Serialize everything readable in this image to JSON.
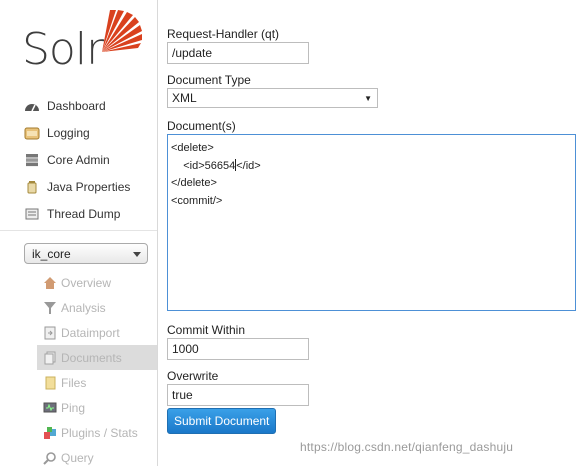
{
  "brand": {
    "logo_text": "Solr",
    "accent": "#d9411e"
  },
  "nav": {
    "items": [
      {
        "label": "Dashboard",
        "icon": "dashboard-icon"
      },
      {
        "label": "Logging",
        "icon": "logging-icon"
      },
      {
        "label": "Core Admin",
        "icon": "core-admin-icon"
      },
      {
        "label": "Java Properties",
        "icon": "java-icon"
      },
      {
        "label": "Thread Dump",
        "icon": "thread-dump-icon"
      }
    ]
  },
  "core_selector": {
    "value": "ik_core"
  },
  "core_menu": {
    "items": [
      {
        "label": "Overview",
        "icon": "home-icon"
      },
      {
        "label": "Analysis",
        "icon": "filter-icon"
      },
      {
        "label": "Dataimport",
        "icon": "dataimport-icon"
      },
      {
        "label": "Documents",
        "icon": "documents-icon",
        "active": true
      },
      {
        "label": "Files",
        "icon": "files-icon"
      },
      {
        "label": "Ping",
        "icon": "ping-icon"
      },
      {
        "label": "Plugins / Stats",
        "icon": "plugins-icon"
      },
      {
        "label": "Query",
        "icon": "query-icon"
      }
    ]
  },
  "form": {
    "request_handler_label": "Request-Handler (qt)",
    "request_handler_value": "/update",
    "document_type_label": "Document Type",
    "document_type_value": "XML",
    "documents_label": "Document(s)",
    "documents_lines": [
      "<delete>",
      "    <id>56654",
      "</id>",
      "</delete>",
      "<commit/>"
    ],
    "commit_within_label": "Commit Within",
    "commit_within_value": "1000",
    "overwrite_label": "Overwrite",
    "overwrite_value": "true",
    "submit_label": "Submit Document"
  },
  "watermark": "https://blog.csdn.net/qianfeng_dashuju"
}
